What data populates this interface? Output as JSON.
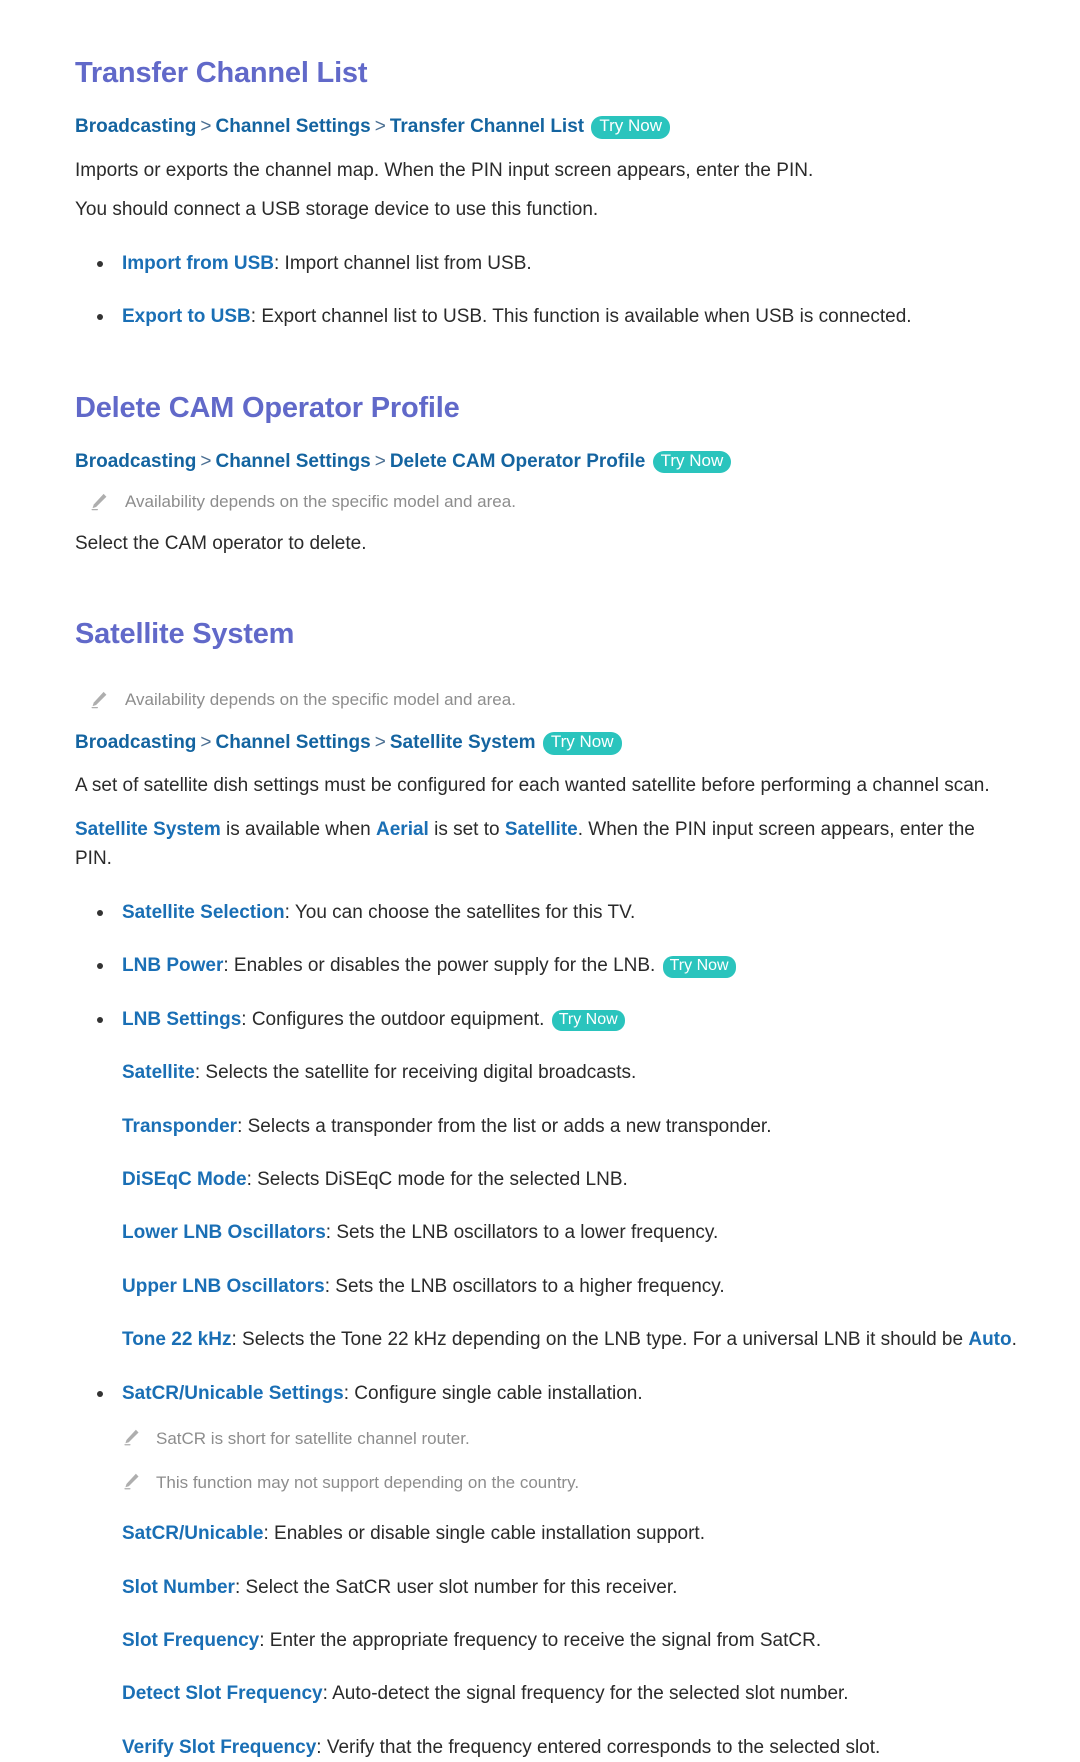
{
  "theme": {
    "heading_color": "#6169c9",
    "link_color": "#1464a0",
    "term_color": "#1a6fb5",
    "badge_bg": "#2ac4bd",
    "badge_text_color": "#ffffff",
    "note_color": "#8d8d8d",
    "body_color": "#2a2a2a",
    "page_bg": "#ffffff"
  },
  "badge": {
    "try_now": "Try Now"
  },
  "breadcrumb_separator": ">",
  "sections": [
    {
      "title": "Transfer Channel List",
      "breadcrumb": [
        "Broadcasting",
        "Channel Settings",
        "Transfer Channel List"
      ],
      "paragraphs": [
        "Imports or exports the channel map. When the PIN input screen appears, enter the PIN.",
        "You should connect a USB storage device to use this function."
      ],
      "bullets": [
        {
          "term": "Import from USB",
          "desc": ": Import channel list from USB."
        },
        {
          "term": "Export to USB",
          "desc": ": Export channel list to USB. This function is available when USB is connected."
        }
      ]
    },
    {
      "title": "Delete CAM Operator Profile",
      "breadcrumb": [
        "Broadcasting",
        "Channel Settings",
        "Delete CAM Operator Profile"
      ],
      "note": "Availability depends on the specific model and area.",
      "paragraph": "Select the CAM operator to delete."
    },
    {
      "title": "Satellite System",
      "note": "Availability depends on the specific model and area.",
      "breadcrumb": [
        "Broadcasting",
        "Channel Settings",
        "Satellite System"
      ],
      "paragraph_1": "A set of satellite dish settings must be configured for each wanted satellite before performing a channel scan.",
      "paragraph_2": {
        "term_1": "Satellite System",
        "text_1": " is available when ",
        "term_2": "Aerial",
        "text_2": " is set to ",
        "term_3": "Satellite",
        "text_3": ". When the PIN input screen appears, enter the PIN."
      },
      "bullets": [
        {
          "term": "Satellite Selection",
          "desc": ": You can choose the satellites for this TV.",
          "badge": ""
        },
        {
          "term": "LNB Power",
          "desc": ": Enables or disables the power supply for the LNB.",
          "badge": "Try Now"
        },
        {
          "term": "LNB Settings",
          "desc": ": Configures the outdoor equipment.",
          "badge": "Try Now"
        }
      ],
      "lnb_sub_items": [
        {
          "term": "Satellite",
          "desc": ": Selects the satellite for receiving digital broadcasts."
        },
        {
          "term": "Transponder",
          "desc": ": Selects a transponder from the list or adds a new transponder."
        },
        {
          "term": "DiSEqC Mode",
          "desc": ": Selects DiSEqC mode for the selected LNB."
        },
        {
          "term": "Lower LNB Oscillators",
          "desc": ": Sets the LNB oscillators to a lower frequency."
        },
        {
          "term": "Upper LNB Oscillators",
          "desc": ": Sets the LNB oscillators to a higher frequency."
        }
      ],
      "tone_item": {
        "term": "Tone 22 kHz",
        "text_1": ": Selects the Tone 22 kHz depending on the LNB type. For a universal LNB it should be ",
        "term_2": "Auto",
        "text_2": "."
      },
      "satcr_bullet": {
        "term": "SatCR/Unicable Settings",
        "desc": ": Configure single cable installation."
      },
      "satcr_notes": [
        "SatCR is short for satellite channel router.",
        "This function may not support depending on the country."
      ],
      "satcr_sub_items": [
        {
          "term": "SatCR/Unicable",
          "desc": ": Enables or disable single cable installation support."
        },
        {
          "term": "Slot Number",
          "desc": ": Select the SatCR user slot number for this receiver."
        },
        {
          "term": "Slot Frequency",
          "desc": ": Enter the appropriate frequency to receive the signal from SatCR."
        },
        {
          "term": "Detect Slot Frequency",
          "desc": ": Auto-detect the signal frequency for the selected slot number."
        },
        {
          "term": "Verify Slot Frequency",
          "desc": ": Verify that the frequency entered corresponds to the selected slot."
        }
      ]
    }
  ]
}
